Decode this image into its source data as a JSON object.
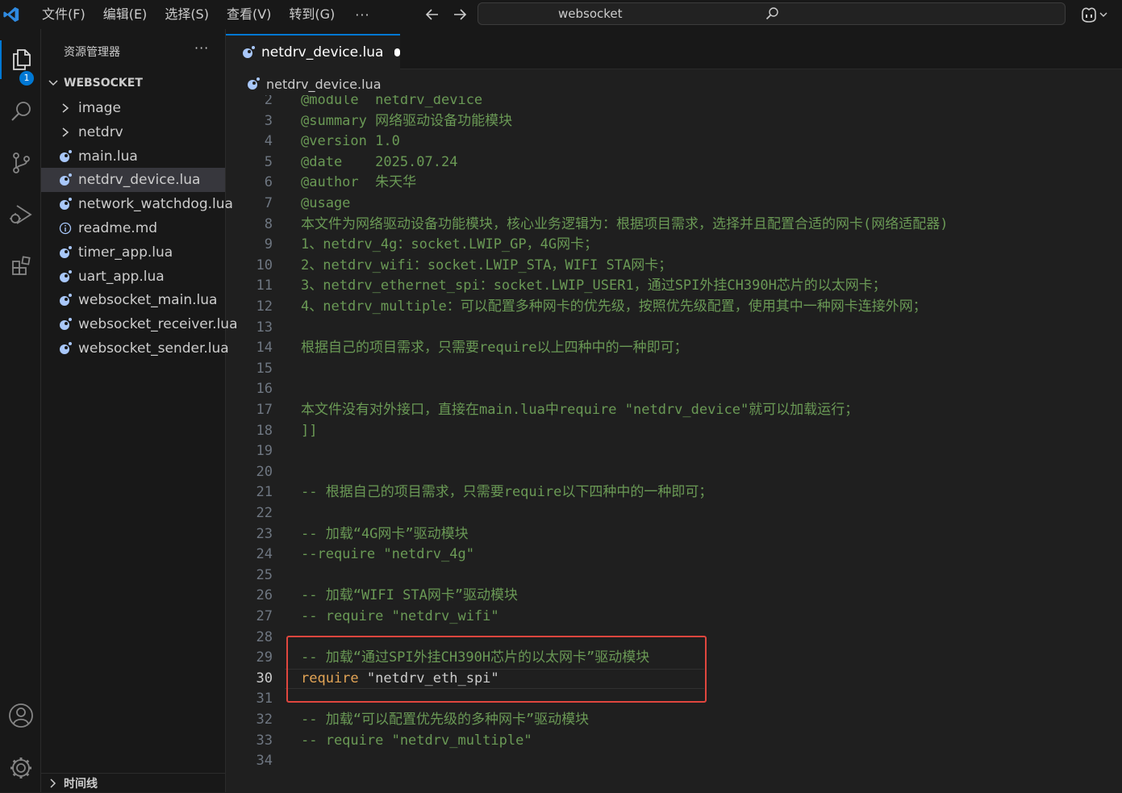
{
  "titlebar": {
    "menus": [
      "文件(F)",
      "编辑(E)",
      "选择(S)",
      "查看(V)",
      "转到(G)"
    ],
    "more": "···",
    "search_text": "websocket",
    "icons": [
      "vscode-logo-icon",
      "back-arrow-icon",
      "forward-arrow-icon",
      "search-icon",
      "copilot-icon",
      "chevron-down-icon"
    ]
  },
  "activity": {
    "explorer_badge": "1",
    "icons": [
      "explorer-icon",
      "search-icon",
      "source-control-icon",
      "run-debug-icon",
      "extensions-icon",
      "account-icon",
      "settings-gear-icon"
    ]
  },
  "sidebar": {
    "header": "资源管理器",
    "dots": "···",
    "section": "WEBSOCKET",
    "items": [
      {
        "name": "image",
        "kind": "folder"
      },
      {
        "name": "netdrv",
        "kind": "folder"
      },
      {
        "name": "main.lua",
        "kind": "lua"
      },
      {
        "name": "netdrv_device.lua",
        "kind": "lua",
        "selected": true
      },
      {
        "name": "network_watchdog.lua",
        "kind": "lua"
      },
      {
        "name": "readme.md",
        "kind": "info"
      },
      {
        "name": "timer_app.lua",
        "kind": "lua"
      },
      {
        "name": "uart_app.lua",
        "kind": "lua"
      },
      {
        "name": "websocket_main.lua",
        "kind": "lua"
      },
      {
        "name": "websocket_receiver.lua",
        "kind": "lua"
      },
      {
        "name": "websocket_sender.lua",
        "kind": "lua"
      }
    ],
    "timeline": "时间线"
  },
  "editor": {
    "tab": "netdrv_device.lua",
    "breadcrumb": "netdrv_device.lua",
    "current_line": 30,
    "lines": [
      {
        "n": "2",
        "t": "@module  netdrv_device",
        "c": "green"
      },
      {
        "n": "3",
        "t": "@summary 网络驱动设备功能模块",
        "c": "green"
      },
      {
        "n": "4",
        "t": "@version 1.0",
        "c": "green"
      },
      {
        "n": "5",
        "t": "@date    2025.07.24",
        "c": "green"
      },
      {
        "n": "6",
        "t": "@author  朱天华",
        "c": "green"
      },
      {
        "n": "7",
        "t": "@usage",
        "c": "green"
      },
      {
        "n": "8",
        "t": "本文件为网络驱动设备功能模块，核心业务逻辑为：根据项目需求，选择并且配置合适的网卡(网络适配器)",
        "c": "green"
      },
      {
        "n": "9",
        "t": "1、netdrv_4g：socket.LWIP_GP，4G网卡；",
        "c": "green"
      },
      {
        "n": "10",
        "t": "2、netdrv_wifi：socket.LWIP_STA，WIFI STA网卡；",
        "c": "green"
      },
      {
        "n": "11",
        "t": "3、netdrv_ethernet_spi：socket.LWIP_USER1，通过SPI外挂CH390H芯片的以太网卡；",
        "c": "green"
      },
      {
        "n": "12",
        "t": "4、netdrv_multiple：可以配置多种网卡的优先级，按照优先级配置，使用其中一种网卡连接外网；",
        "c": "green"
      },
      {
        "n": "13",
        "t": "",
        "c": "green"
      },
      {
        "n": "14",
        "t": "根据自己的项目需求，只需要require以上四种中的一种即可；",
        "c": "green"
      },
      {
        "n": "15",
        "t": "",
        "c": "green"
      },
      {
        "n": "16",
        "t": "",
        "c": "green"
      },
      {
        "n": "17",
        "t": "本文件没有对外接口，直接在main.lua中require \"netdrv_device\"就可以加载运行；",
        "c": "green"
      },
      {
        "n": "18",
        "t": "]]",
        "c": "green"
      },
      {
        "n": "19",
        "t": "",
        "c": "green"
      },
      {
        "n": "20",
        "t": "",
        "c": "green"
      },
      {
        "n": "21",
        "t": "-- 根据自己的项目需求，只需要require以下四种中的一种即可；",
        "c": "green"
      },
      {
        "n": "22",
        "t": "",
        "c": "green"
      },
      {
        "n": "23",
        "t": "-- 加载“4G网卡”驱动模块",
        "c": "green"
      },
      {
        "n": "24",
        "t": "--require \"netdrv_4g\"",
        "c": "green"
      },
      {
        "n": "25",
        "t": "",
        "c": "green"
      },
      {
        "n": "26",
        "t": "-- 加载“WIFI STA网卡”驱动模块",
        "c": "green"
      },
      {
        "n": "27",
        "t": "-- require \"netdrv_wifi\"",
        "c": "green"
      },
      {
        "n": "28",
        "t": "",
        "c": "green"
      },
      {
        "n": "29",
        "t": "-- 加载“通过SPI外挂CH390H芯片的以太网卡”驱动模块",
        "c": "green"
      },
      {
        "n": "30",
        "t": "require",
        "t2": " \"netdrv_eth_spi\"",
        "c": "code"
      },
      {
        "n": "31",
        "t": "",
        "c": "green"
      },
      {
        "n": "32",
        "t": "-- 加载“可以配置优先级的多种网卡”驱动模块",
        "c": "green"
      },
      {
        "n": "33",
        "t": "-- require \"netdrv_multiple\"",
        "c": "green"
      },
      {
        "n": "34",
        "t": "",
        "c": "green"
      }
    ]
  },
  "colors": {
    "accent": "#0078d4",
    "comment": "#6a9955",
    "keyword": "#e2a456",
    "string": "#ce9178",
    "highlight_box": "#e0463e"
  }
}
